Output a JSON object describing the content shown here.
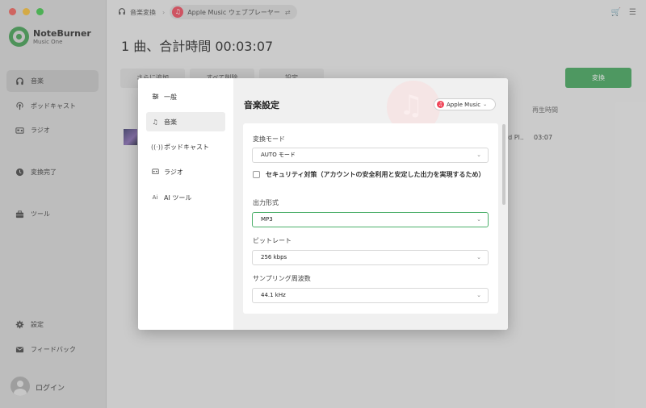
{
  "app": {
    "name": "NoteBurner",
    "subtitle": "Music One"
  },
  "sidebar": {
    "items": [
      {
        "label": "音楽",
        "icon": "headphones-icon"
      },
      {
        "label": "ポッドキャスト",
        "icon": "podcast-icon"
      },
      {
        "label": "ラジオ",
        "icon": "radio-icon"
      },
      {
        "label": "変換完了",
        "icon": "clock-icon"
      },
      {
        "label": "ツール",
        "icon": "toolbox-icon"
      },
      {
        "label": "設定",
        "icon": "gear-icon"
      },
      {
        "label": "フィードバック",
        "icon": "mail-icon"
      }
    ],
    "login": "ログイン"
  },
  "topbar": {
    "crumb": "音楽変換",
    "source": "Apple Music ウェブプレーヤー"
  },
  "main": {
    "title": "1 曲、合計時間 00:03:07",
    "toolbar": [
      "さらに追加",
      "すべて削除",
      "設定"
    ],
    "convert": "変換",
    "col_duration": "再生時間",
    "row": {
      "album": "rd Pl...",
      "time": "03:07"
    }
  },
  "modal": {
    "menu": [
      {
        "label": "一般",
        "icon": "sliders-icon"
      },
      {
        "label": "音楽",
        "icon": "music-note-icon"
      },
      {
        "label": "ポッドキャスト",
        "icon": "podcast-icon"
      },
      {
        "label": "ラジオ",
        "icon": "radio-icon"
      },
      {
        "label": "AI ツール",
        "icon": "ai-icon"
      }
    ],
    "title": "音楽設定",
    "source_select": "Apple Music",
    "fields": {
      "mode_label": "変換モード",
      "mode_value": "AUTO モード",
      "security_text": "セキュリティ対策（アカウントの安全利用と安定した出力を実現するため）",
      "format_label": "出力形式",
      "format_value": "MP3",
      "bitrate_label": "ビットレート",
      "bitrate_value": "256 kbps",
      "samplerate_label": "サンプリング周波数",
      "samplerate_value": "44.1 kHz"
    }
  },
  "colors": {
    "accent": "#3fa659",
    "apple_music": "#f0475a"
  }
}
